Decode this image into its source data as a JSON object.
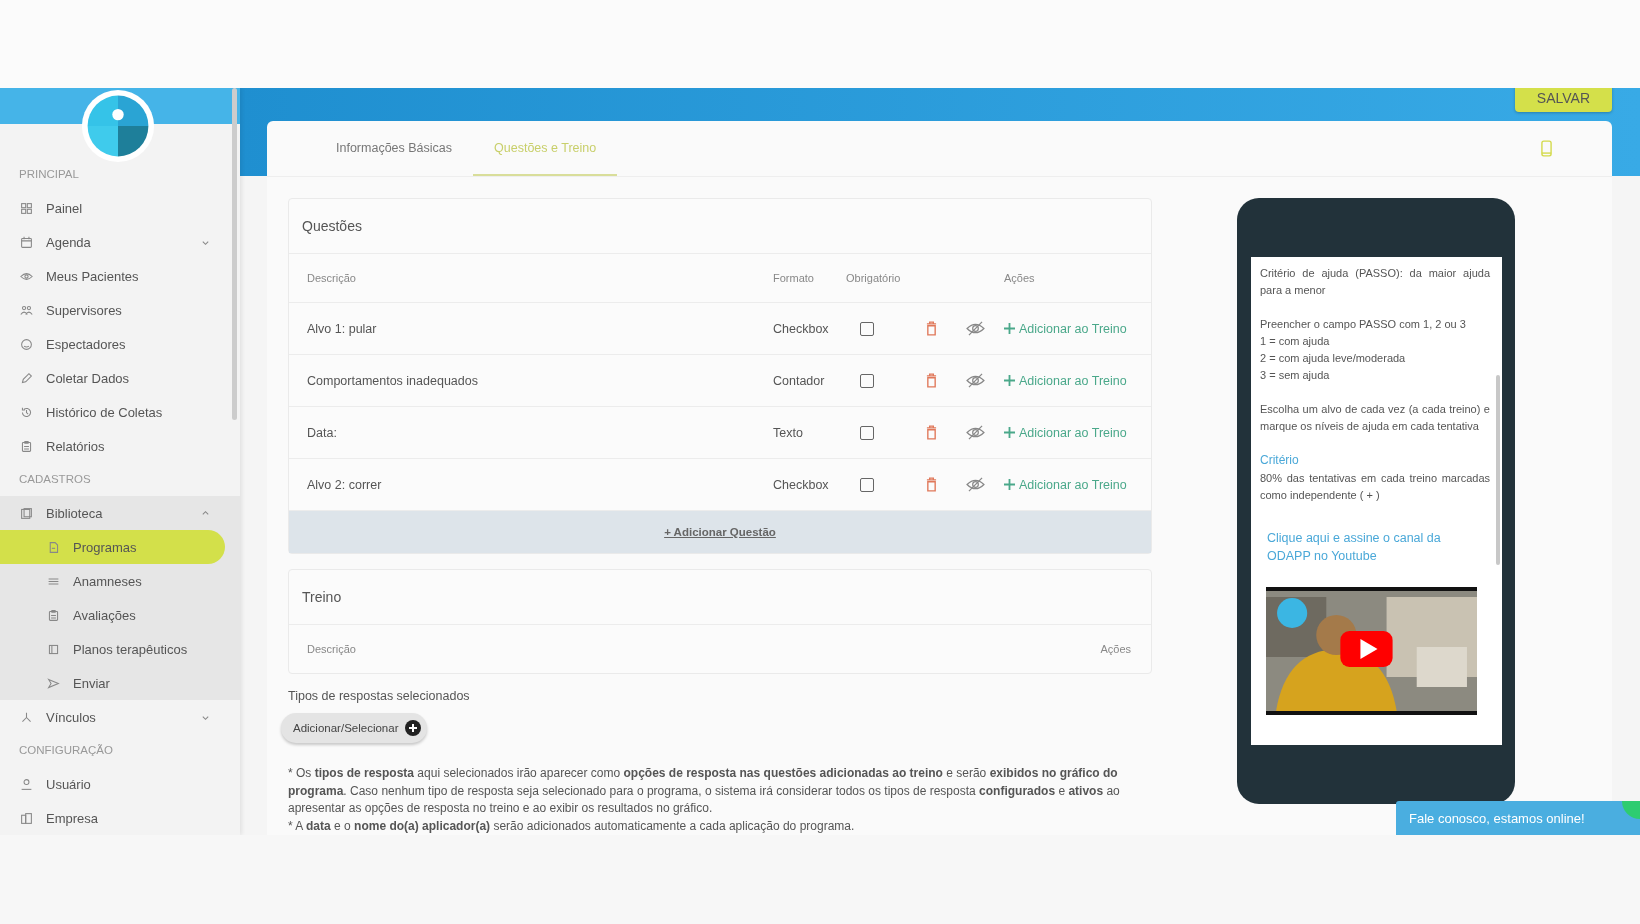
{
  "sidebar": {
    "sections": [
      {
        "title": "PRINCIPAL",
        "items": [
          {
            "label": "Painel",
            "selected": false
          },
          {
            "label": "Agenda",
            "selected": false,
            "expanded": false
          },
          {
            "label": "Meus Pacientes",
            "selected": false
          },
          {
            "label": "Supervisores",
            "selected": false
          },
          {
            "label": "Espectadores",
            "selected": false
          },
          {
            "label": "Coletar Dados",
            "selected": false
          },
          {
            "label": "Histórico de Coletas",
            "selected": false
          },
          {
            "label": "Relatórios",
            "selected": false
          }
        ]
      },
      {
        "title": "CADASTROS",
        "items": [
          {
            "label": "Biblioteca",
            "selected": false,
            "expanded": true,
            "children": [
              {
                "label": "Programas",
                "selected": true
              },
              {
                "label": "Anamneses",
                "selected": false
              },
              {
                "label": "Avaliações",
                "selected": false
              },
              {
                "label": "Planos terapêuticos",
                "selected": false
              },
              {
                "label": "Enviar",
                "selected": false
              }
            ]
          },
          {
            "label": "Vínculos",
            "selected": false,
            "expanded": false
          }
        ]
      },
      {
        "title": "CONFIGURAÇÃO",
        "items": [
          {
            "label": "Usuário",
            "selected": false
          },
          {
            "label": "Empresa",
            "selected": false
          }
        ]
      }
    ]
  },
  "save_button": "SALVAR",
  "tabs": [
    {
      "label": "Informações Básicas",
      "selected": false
    },
    {
      "label": "Questões e Treino",
      "selected": true
    }
  ],
  "questions": {
    "title": "Questões",
    "columns": [
      "Descrição",
      "Formato",
      "Obrigatório",
      "Ações"
    ],
    "rows": [
      {
        "description": "Alvo 1: pular",
        "format": "Checkbox",
        "required": false,
        "action": "Adicionar ao Treino"
      },
      {
        "description": "Comportamentos inadequados",
        "format": "Contador",
        "required": false,
        "action": "Adicionar ao Treino"
      },
      {
        "description": "Data:",
        "format": "Texto",
        "required": false,
        "action": "Adicionar ao Treino"
      },
      {
        "description": "Alvo 2: correr",
        "format": "Checkbox",
        "required": false,
        "action": "Adicionar ao Treino"
      }
    ],
    "add_button": "+ Adicionar Questão"
  },
  "training": {
    "title": "Treino",
    "columns": [
      "Descrição",
      "Ações"
    ]
  },
  "response_types": {
    "label": "Tipos de respostas selecionados",
    "button": "Adicionar/Selecionar"
  },
  "notes": [
    "* Os **tipos de resposta** aqui selecionados irão aparecer como **opções de resposta nas questões adicionadas ao treino** e serão **exibidos no gráfico do programa**. Caso nenhum tipo de resposta seja selecionado para o programa, o sistema irá considerar todos os tipos de resposta **configurados** e **ativos** ao apresentar as opções de resposta no treino e ao exibir os resultados no gráfico.",
    "* A **data** e o **nome do(a) aplicador(a)** serão adicionados automaticamente a cada aplicação do programa."
  ],
  "preview": {
    "blocks": [
      {
        "kind": "text",
        "lines": [
          "Critério de ajuda (PASSO): da maior ajuda para a menor"
        ]
      },
      {
        "kind": "text",
        "lines": [
          "Preencher o campo PASSO com 1, 2 ou 3",
          "1 = com ajuda",
          "2 = com ajuda leve/moderada",
          "3 = sem ajuda"
        ]
      },
      {
        "kind": "text",
        "lines": [
          "Escolha um alvo de cada vez (a cada treino) e marque os níveis de ajuda em cada tentativa"
        ]
      },
      {
        "kind": "heading",
        "text": "Critério"
      },
      {
        "kind": "text",
        "lines": [
          "80% das tentativas em cada treino marcadas como independente ( + )"
        ]
      },
      {
        "kind": "link",
        "text": "Clique aqui e assine o canal da ODAPP no Youtube"
      },
      {
        "kind": "video"
      }
    ]
  },
  "chat": "Fale conosco, estamos online!"
}
